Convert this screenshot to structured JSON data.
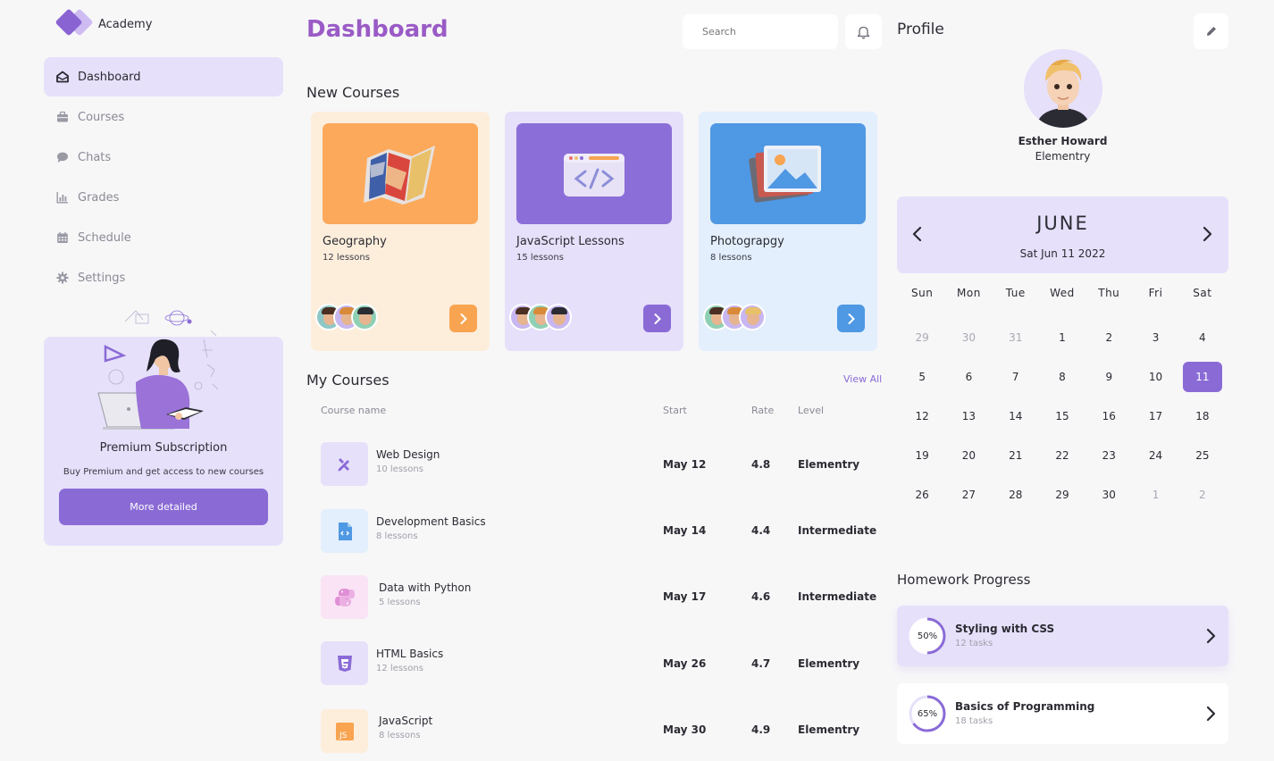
{
  "app": {
    "name": "Academy"
  },
  "sidebar": {
    "items": [
      {
        "label": "Dashboard",
        "icon": "dashboard-icon",
        "active": true
      },
      {
        "label": "Courses",
        "icon": "briefcase-icon",
        "active": false
      },
      {
        "label": "Chats",
        "icon": "chat-icon",
        "active": false
      },
      {
        "label": "Grades",
        "icon": "bar-chart-icon",
        "active": false
      },
      {
        "label": "Schedule",
        "icon": "calendar-icon",
        "active": false
      },
      {
        "label": "Settings",
        "icon": "gear-icon",
        "active": false
      }
    ],
    "premium": {
      "title": "Premium Subscription",
      "description": "Buy Premium and get access to new courses",
      "button": "More detailed"
    }
  },
  "header": {
    "title": "Dashboard",
    "search_placeholder": "Search"
  },
  "new_courses": {
    "title": "New Courses",
    "cards": [
      {
        "name": "Geography",
        "lessons": "12 lessons",
        "bg": "#fdeedc",
        "thumb": "#fca95b",
        "accent": "#f8a451",
        "icon": "map-icon"
      },
      {
        "name": "JavaScript Lessons",
        "lessons": "15 lessons",
        "bg": "#e6e0fa",
        "thumb": "#8c6ed8",
        "accent": "#8a6bd6",
        "icon": "code-icon"
      },
      {
        "name": "Photograpgy",
        "lessons": "8 lessons",
        "bg": "#e3effc",
        "thumb": "#4f98e3",
        "accent": "#4f98e3",
        "icon": "photo-icon"
      }
    ]
  },
  "my_courses": {
    "title": "My Courses",
    "view_all": "View All",
    "columns": [
      "Course name",
      "Start",
      "Rate",
      "Level"
    ],
    "rows": [
      {
        "name": "Web Design",
        "lessons": "10 lessons",
        "start": "May 12",
        "rate": "4.8",
        "level": "Elementry",
        "icon": "design-tools-icon",
        "icon_bg": "#e6e0fa",
        "icon_color": "#8a6bd6"
      },
      {
        "name": "Development Basics",
        "lessons": "8 lessons",
        "start": "May 14",
        "rate": "4.4",
        "level": "Intermediate",
        "icon": "code-file-icon",
        "icon_bg": "#e3effc",
        "icon_color": "#4f98e3"
      },
      {
        "name": "Data with Python",
        "lessons": "5 lessons",
        "start": "May 17",
        "rate": "4.6",
        "level": "Intermediate",
        "icon": "python-icon",
        "icon_bg": "#fbe3f6",
        "icon_color": "#e08fd6"
      },
      {
        "name": "HTML Basics",
        "lessons": "12 lessons",
        "start": "May 26",
        "rate": "4.7",
        "level": "Elementry",
        "icon": "html5-icon",
        "icon_bg": "#e6e0fa",
        "icon_color": "#8a6bd6"
      },
      {
        "name": "JavaScript",
        "lessons": "8 lessons",
        "start": "May 30",
        "rate": "4.9",
        "level": "Elementry",
        "icon": "js-icon",
        "icon_bg": "#fdeedc",
        "icon_color": "#f8a451"
      }
    ]
  },
  "profile": {
    "title": "Profile",
    "name": "Esther Howard",
    "level": "Elementry"
  },
  "calendar": {
    "month": "JUNE",
    "date_label": "Sat Jun 11 2022",
    "weekdays": [
      "Sun",
      "Mon",
      "Tue",
      "Wed",
      "Thu",
      "Fri",
      "Sat"
    ],
    "weeks": [
      [
        "29",
        "30",
        "31",
        "1",
        "2",
        "3",
        "4"
      ],
      [
        "5",
        "6",
        "7",
        "8",
        "9",
        "10",
        "11"
      ],
      [
        "12",
        "13",
        "14",
        "15",
        "16",
        "17",
        "18"
      ],
      [
        "19",
        "20",
        "21",
        "22",
        "23",
        "24",
        "25"
      ],
      [
        "26",
        "27",
        "28",
        "29",
        "30",
        "1",
        "2"
      ]
    ],
    "selected": "11"
  },
  "homework": {
    "title": "Homework Progress",
    "items": [
      {
        "name": "Styling with CSS",
        "tasks": "12 tasks",
        "percent_label": "50%",
        "progress": 0.5,
        "bg": "#e6e0fa"
      },
      {
        "name": "Basics of Programming",
        "tasks": "18 tasks",
        "percent_label": "65%",
        "progress": 0.65,
        "bg": "#ffffff"
      }
    ]
  },
  "colors": {
    "accent": "#8a6bd6",
    "title_gradient": "#9a5bc6",
    "page_bg": "#f7f7f8"
  }
}
